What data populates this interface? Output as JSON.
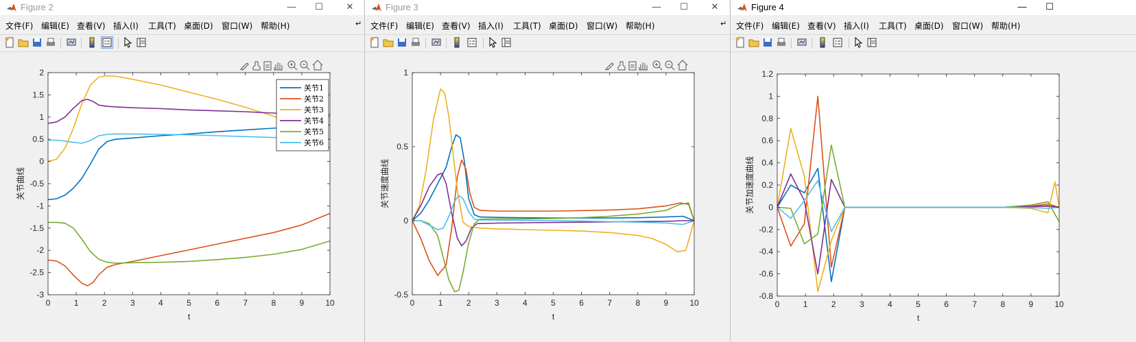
{
  "windows": [
    {
      "title": "Figure 2",
      "active": false,
      "controls": [
        "—",
        "☐",
        "✕"
      ]
    },
    {
      "title": "Figure 3",
      "active": false,
      "controls": [
        "—",
        "☐",
        "✕"
      ]
    },
    {
      "title": "Figure 4",
      "active": true,
      "controls": [
        "—",
        "☐"
      ]
    }
  ],
  "menu": [
    "文件(F)",
    "编辑(E)",
    "查看(V)",
    "插入(I)",
    "工具(T)",
    "桌面(D)",
    "窗口(W)",
    "帮助(H)"
  ],
  "menu_overflow": "↵",
  "icons": {
    "toolbar": [
      "new-figure-icon",
      "open-file-icon",
      "save-icon",
      "print-icon",
      "link-plot-icon",
      "colorbar-icon",
      "legend-icon",
      "pointer-icon",
      "property-editor-icon"
    ],
    "axes_toolbar": [
      "brush-icon",
      "data-tip-icon",
      "data-cursor-icon",
      "pan-icon",
      "zoom-in-icon",
      "zoom-out-icon",
      "home-icon"
    ]
  },
  "colors": [
    "#0072BD",
    "#D95319",
    "#EDB120",
    "#7E2F8E",
    "#77AC30",
    "#4DBEEE"
  ],
  "chart_data": [
    {
      "type": "line",
      "xlabel": "t",
      "ylabel": "关节曲线",
      "xlim": [
        0,
        10
      ],
      "ylim": [
        -3,
        2
      ],
      "xticks": [
        0,
        1,
        2,
        3,
        4,
        5,
        6,
        7,
        8,
        9,
        10
      ],
      "yticks": [
        -3,
        -2.5,
        -2,
        -1.5,
        -1,
        -0.5,
        0,
        0.5,
        1,
        1.5,
        2
      ],
      "legend_position": "top-right",
      "series": [
        {
          "name": "关节1",
          "x": [
            0,
            0.3,
            0.6,
            0.9,
            1.2,
            1.5,
            1.8,
            2.1,
            2.4,
            3,
            4,
            5,
            6,
            7,
            8,
            9,
            10
          ],
          "y": [
            -0.86,
            -0.84,
            -0.76,
            -0.6,
            -0.38,
            -0.06,
            0.28,
            0.45,
            0.5,
            0.53,
            0.58,
            0.62,
            0.67,
            0.71,
            0.75,
            0.79,
            0.82
          ]
        },
        {
          "name": "关节2",
          "x": [
            0,
            0.3,
            0.6,
            0.9,
            1.2,
            1.4,
            1.6,
            1.8,
            2.1,
            2.4,
            3,
            4,
            5,
            6,
            7,
            8,
            9,
            10
          ],
          "y": [
            -2.22,
            -2.24,
            -2.35,
            -2.56,
            -2.74,
            -2.8,
            -2.72,
            -2.55,
            -2.38,
            -2.32,
            -2.25,
            -2.12,
            -1.99,
            -1.86,
            -1.73,
            -1.6,
            -1.43,
            -1.17
          ]
        },
        {
          "name": "关节3",
          "x": [
            0,
            0.3,
            0.6,
            0.9,
            1.2,
            1.5,
            1.8,
            2.1,
            2.4,
            3,
            4,
            5,
            6,
            7,
            8,
            9,
            9.5,
            10
          ],
          "y": [
            0,
            0.05,
            0.3,
            0.75,
            1.3,
            1.72,
            1.9,
            1.93,
            1.92,
            1.85,
            1.72,
            1.56,
            1.4,
            1.22,
            1.02,
            0.8,
            0.65,
            0.3
          ]
        },
        {
          "name": "关节4",
          "x": [
            0,
            0.3,
            0.6,
            0.9,
            1.2,
            1.4,
            1.6,
            1.8,
            2.1,
            2.4,
            3,
            4,
            5,
            6,
            7,
            8,
            9,
            10
          ],
          "y": [
            0.86,
            0.89,
            1.0,
            1.2,
            1.37,
            1.4,
            1.35,
            1.27,
            1.24,
            1.23,
            1.21,
            1.19,
            1.16,
            1.14,
            1.12,
            1.09,
            1.07,
            1.05
          ]
        },
        {
          "name": "关节5",
          "x": [
            0,
            0.3,
            0.6,
            0.9,
            1.2,
            1.5,
            1.8,
            2.1,
            2.4,
            3,
            4,
            5,
            6,
            7,
            8,
            9,
            10
          ],
          "y": [
            -1.37,
            -1.37,
            -1.39,
            -1.5,
            -1.75,
            -2.03,
            -2.2,
            -2.27,
            -2.29,
            -2.28,
            -2.27,
            -2.25,
            -2.21,
            -2.16,
            -2.09,
            -1.98,
            -1.79
          ]
        },
        {
          "name": "关节6",
          "x": [
            0,
            0.3,
            0.6,
            0.9,
            1.2,
            1.5,
            1.8,
            2.1,
            2.4,
            3,
            4,
            5,
            6,
            7,
            8,
            9,
            10
          ],
          "y": [
            0.48,
            0.48,
            0.46,
            0.43,
            0.41,
            0.47,
            0.58,
            0.61,
            0.62,
            0.62,
            0.61,
            0.6,
            0.58,
            0.56,
            0.54,
            0.52,
            0.5
          ]
        }
      ]
    },
    {
      "type": "line",
      "xlabel": "t",
      "ylabel": "关节速度曲线",
      "xlim": [
        0,
        10
      ],
      "ylim": [
        -0.5,
        1
      ],
      "xticks": [
        0,
        1,
        2,
        3,
        4,
        5,
        6,
        7,
        8,
        9,
        10
      ],
      "yticks": [
        -0.5,
        0,
        0.5,
        1
      ],
      "series": [
        {
          "x": [
            0,
            0.3,
            0.6,
            0.9,
            1.2,
            1.4,
            1.55,
            1.7,
            1.85,
            2.0,
            2.2,
            2.4,
            3,
            4,
            5,
            6,
            7,
            8,
            9,
            9.6,
            10
          ],
          "y": [
            0,
            0.05,
            0.14,
            0.25,
            0.36,
            0.5,
            0.58,
            0.56,
            0.4,
            0.15,
            0.04,
            0.025,
            0.022,
            0.02,
            0.018,
            0.018,
            0.018,
            0.02,
            0.025,
            0.03,
            0
          ]
        },
        {
          "x": [
            0,
            0.3,
            0.6,
            0.9,
            1.2,
            1.4,
            1.6,
            1.75,
            1.9,
            2.05,
            2.2,
            2.4,
            3,
            4,
            5,
            6,
            7,
            8,
            9,
            9.5,
            9.8,
            10
          ],
          "y": [
            0,
            -0.12,
            -0.27,
            -0.37,
            -0.3,
            -0.05,
            0.3,
            0.41,
            0.35,
            0.18,
            0.09,
            0.07,
            0.065,
            0.065,
            0.065,
            0.068,
            0.072,
            0.08,
            0.1,
            0.12,
            0.11,
            0
          ]
        },
        {
          "x": [
            0,
            0.25,
            0.5,
            0.75,
            1.0,
            1.15,
            1.3,
            1.45,
            1.6,
            1.8,
            2.0,
            2.2,
            2.4,
            3,
            4,
            5,
            6,
            7,
            8,
            8.5,
            9,
            9.4,
            9.7,
            10
          ],
          "y": [
            0,
            0.1,
            0.35,
            0.68,
            0.89,
            0.86,
            0.7,
            0.45,
            0.2,
            -0.01,
            -0.04,
            -0.045,
            -0.05,
            -0.055,
            -0.06,
            -0.065,
            -0.07,
            -0.08,
            -0.1,
            -0.12,
            -0.16,
            -0.21,
            -0.2,
            0
          ]
        },
        {
          "x": [
            0,
            0.3,
            0.6,
            0.9,
            1.05,
            1.2,
            1.4,
            1.6,
            1.75,
            1.9,
            2.1,
            2.3,
            2.6,
            3,
            4,
            5,
            6,
            7,
            8,
            9,
            9.6,
            10
          ],
          "y": [
            0,
            0.1,
            0.23,
            0.31,
            0.32,
            0.25,
            0.05,
            -0.12,
            -0.17,
            -0.14,
            -0.05,
            -0.02,
            -0.018,
            -0.016,
            -0.014,
            -0.012,
            -0.01,
            -0.008,
            -0.006,
            -0.004,
            0,
            0
          ]
        },
        {
          "x": [
            0,
            0.3,
            0.6,
            0.9,
            1.1,
            1.3,
            1.5,
            1.65,
            1.8,
            2.0,
            2.2,
            2.4,
            3,
            4,
            5,
            6,
            7,
            8,
            9,
            9.5,
            9.8,
            10
          ],
          "y": [
            0,
            0.0,
            -0.02,
            -0.1,
            -0.25,
            -0.4,
            -0.48,
            -0.47,
            -0.35,
            -0.15,
            -0.02,
            0.01,
            0.012,
            0.012,
            0.015,
            0.02,
            0.03,
            0.045,
            0.07,
            0.11,
            0.12,
            0
          ]
        },
        {
          "x": [
            0,
            0.3,
            0.6,
            0.9,
            1.1,
            1.3,
            1.5,
            1.65,
            1.8,
            2.0,
            2.2,
            2.4,
            3,
            4,
            5,
            6,
            7,
            8,
            9,
            9.6,
            10
          ],
          "y": [
            0,
            0.0,
            -0.03,
            -0.06,
            -0.05,
            0.03,
            0.13,
            0.17,
            0.15,
            0.06,
            0.01,
            0.005,
            0.004,
            0.002,
            0,
            -0.003,
            -0.006,
            -0.01,
            -0.016,
            -0.025,
            0
          ]
        }
      ]
    },
    {
      "type": "line",
      "xlabel": "t",
      "ylabel": "关节加速度曲线",
      "xlim": [
        0,
        10
      ],
      "ylim": [
        -0.8,
        1.2
      ],
      "xticks": [
        0,
        1,
        2,
        3,
        4,
        5,
        6,
        7,
        8,
        9,
        10
      ],
      "yticks": [
        -0.8,
        -0.6,
        -0.4,
        -0.2,
        0,
        0.2,
        0.4,
        0.6,
        0.8,
        1,
        1.2
      ],
      "series": [
        {
          "x": [
            0,
            0.48,
            0.96,
            1.44,
            1.92,
            2.4,
            3,
            4,
            5,
            6,
            7,
            8,
            9,
            9.6,
            10
          ],
          "y": [
            0,
            0.2,
            0.13,
            0.35,
            -0.67,
            0.0,
            0,
            0,
            0,
            0,
            0,
            0,
            0.005,
            0.015,
            0
          ]
        },
        {
          "x": [
            0,
            0.48,
            0.96,
            1.44,
            1.92,
            2.4,
            3,
            4,
            5,
            6,
            7,
            8,
            9,
            9.6,
            10
          ],
          "y": [
            0,
            -0.35,
            -0.15,
            1.0,
            -0.54,
            0.0,
            0,
            0,
            0,
            0,
            0,
            0,
            0.01,
            0.03,
            0
          ]
        },
        {
          "x": [
            0,
            0.48,
            0.96,
            1.44,
            1.92,
            2.4,
            3,
            4,
            5,
            6,
            7,
            8,
            9,
            9.6,
            9.85,
            10
          ],
          "y": [
            0,
            0.71,
            0.28,
            -0.76,
            -0.3,
            0.0,
            0,
            0,
            0,
            0,
            0,
            0,
            -0.01,
            -0.05,
            0.23,
            0
          ]
        },
        {
          "x": [
            0,
            0.48,
            0.96,
            1.44,
            1.92,
            2.4,
            3,
            4,
            5,
            6,
            7,
            8,
            9,
            9.6,
            10
          ],
          "y": [
            0,
            0.3,
            0.06,
            -0.6,
            0.25,
            0.0,
            0,
            0,
            0,
            0,
            0,
            0,
            0.005,
            0.01,
            0
          ]
        },
        {
          "x": [
            0,
            0.48,
            0.96,
            1.44,
            1.92,
            2.4,
            3,
            4,
            5,
            6,
            7,
            8,
            9,
            9.6,
            10
          ],
          "y": [
            0,
            -0.01,
            -0.33,
            -0.24,
            0.56,
            0.0,
            0,
            0,
            0,
            0,
            0,
            0,
            0.02,
            0.05,
            -0.13
          ]
        },
        {
          "x": [
            0,
            0.48,
            0.96,
            1.44,
            1.92,
            2.4,
            3,
            4,
            5,
            6,
            7,
            8,
            9,
            9.6,
            10
          ],
          "y": [
            0,
            -0.1,
            0.06,
            0.24,
            -0.22,
            0.0,
            0,
            0,
            0,
            0,
            0,
            0,
            -0.003,
            -0.01,
            0
          ]
        }
      ]
    }
  ]
}
